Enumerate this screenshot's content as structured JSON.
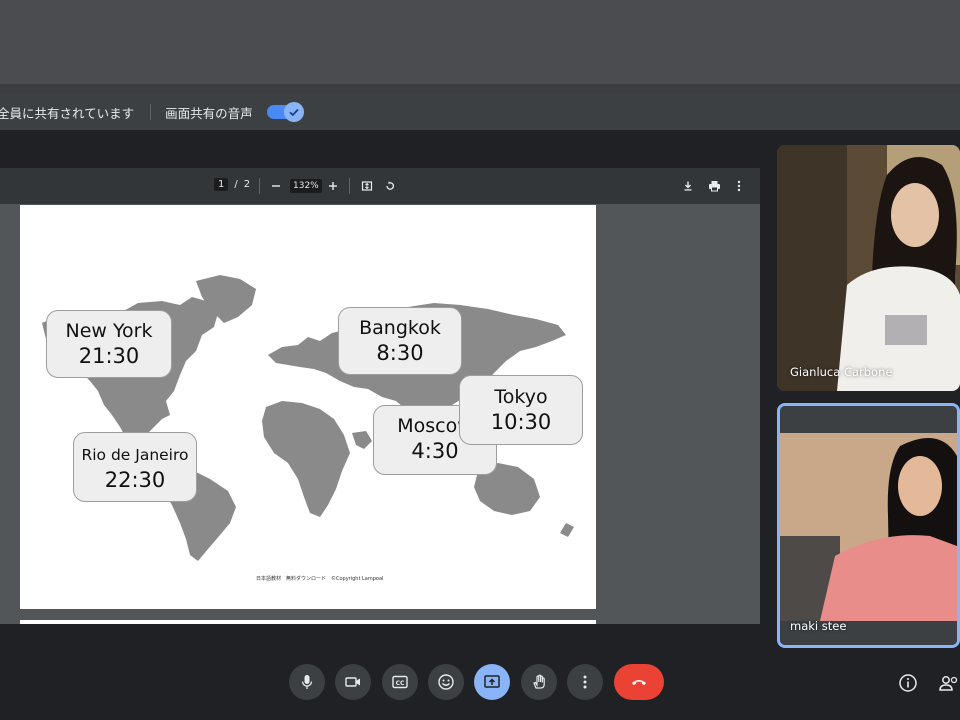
{
  "share_bar": {
    "sharing_text": "全員に共有されています",
    "audio_label": "画面共有の音声",
    "audio_toggle": "on"
  },
  "pdf_viewer": {
    "current_page": "1",
    "total_pages": "2",
    "zoom": "132%",
    "copyright": "日本語教材　無料ダウンロード　©Copyright Lampoal"
  },
  "map_labels": [
    {
      "city": "Moscow",
      "time": "4:30"
    },
    {
      "city": "New York",
      "time": "21:30"
    },
    {
      "city": "Bangkok",
      "time": "8:30"
    },
    {
      "city": "Tokyo",
      "time": "10:30"
    },
    {
      "city": "Rio de Janeiro",
      "time": "22:30"
    }
  ],
  "participants": [
    {
      "name": "Gianluca Carbone"
    },
    {
      "name": "maki stee"
    }
  ],
  "colors": {
    "accent": "#8ab4f8",
    "end_call": "#ea4335",
    "map_land": "#8a8a8a"
  }
}
